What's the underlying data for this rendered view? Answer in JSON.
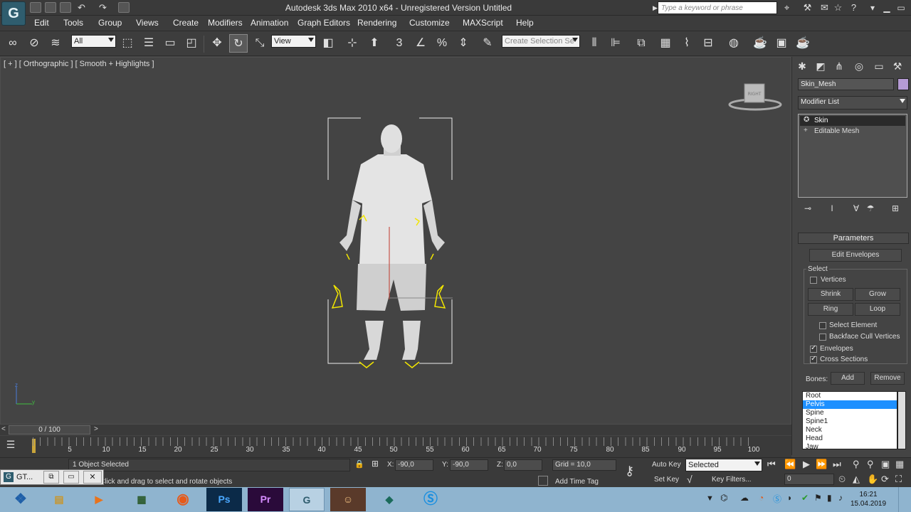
{
  "titlebar": {
    "logo": "G",
    "title": "Autodesk 3ds Max  2010 x64  -  Unregistered Version    Untitled",
    "search_placeholder": "Type a keyword or phrase"
  },
  "menu": [
    "Edit",
    "Tools",
    "Group",
    "Views",
    "Create",
    "Modifiers",
    "Animation",
    "Graph Editors",
    "Rendering",
    "Customize",
    "MAXScript",
    "Help"
  ],
  "toolbar": {
    "filter_value": "All",
    "refcoord_value": "View",
    "selection_set_placeholder": "Create Selection Se"
  },
  "viewport": {
    "label": "[ + ] [ Orthographic ] [ Smooth + Highlights ]",
    "viewcube_label": "RIGHT",
    "axis_z": "z",
    "axis_y": "y"
  },
  "command_panel": {
    "object_name": "Skin_Mesh",
    "object_color": "#b59bd4",
    "modifier_list_label": "Modifier List",
    "stack": [
      {
        "label": "Skin",
        "selected": true
      },
      {
        "label": "Editable Mesh",
        "selected": false
      }
    ],
    "rollout_title": "Parameters",
    "edit_envelopes": "Edit Envelopes",
    "select_group": "Select",
    "vertices_label": "Vertices",
    "shrink": "Shrink",
    "grow": "Grow",
    "ring": "Ring",
    "loop": "Loop",
    "select_element": "Select Element",
    "backface_cull": "Backface Cull Vertices",
    "envelopes": "Envelopes",
    "cross_sections": "Cross Sections",
    "bones_label": "Bones:",
    "add": "Add",
    "remove": "Remove",
    "bones": [
      "Root",
      "Pelvis",
      "Spine",
      "Spine1",
      "Neck",
      "Head",
      "Jaw"
    ],
    "selected_bone": "Pelvis"
  },
  "timeline": {
    "frame_display": "0 / 100",
    "ticks": [
      "5",
      "10",
      "15",
      "20",
      "25",
      "30",
      "35",
      "40",
      "45",
      "50",
      "55",
      "60",
      "65",
      "70",
      "75",
      "80",
      "85",
      "90",
      "95",
      "100"
    ]
  },
  "status": {
    "selection_info": "1 Object Selected",
    "prompt": "Click and drag to select and rotate objects",
    "x_label": "X:",
    "x_value": "-90,0",
    "y_label": "Y:",
    "y_value": "-90,0",
    "z_label": "Z:",
    "z_value": "0,0",
    "grid": "Grid = 10,0",
    "add_time_tag": "Add Time Tag",
    "auto_key": "Auto Key",
    "set_key": "Set Key",
    "selected_dropdown": "Selected",
    "key_filters": "Key Filters...",
    "frame_field": "0"
  },
  "taskbar": {
    "minimized_window": "GT...",
    "apps": [
      "Start",
      "Explorer",
      "Media Player",
      "Tool",
      "Opera",
      "Ps",
      "Pr",
      "3ds Max",
      "Avatar",
      "App",
      "Skype"
    ],
    "time": "16:21",
    "date": "15.04.2019"
  }
}
